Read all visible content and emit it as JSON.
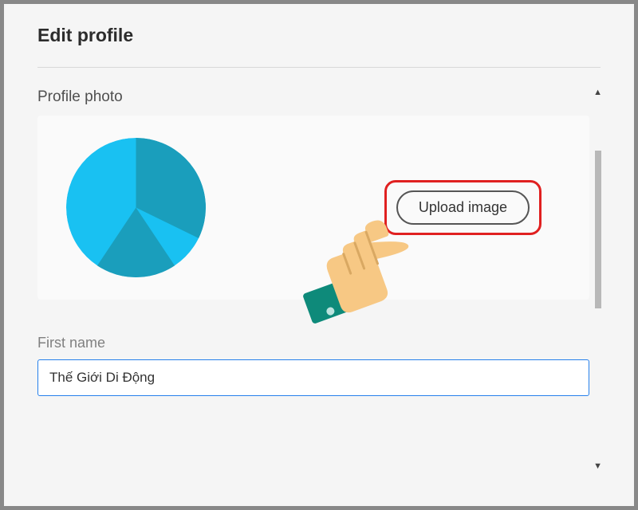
{
  "header": {
    "title": "Edit profile"
  },
  "profile_photo": {
    "section_label": "Profile photo",
    "upload_button_label": "Upload image"
  },
  "first_name": {
    "label": "First name",
    "value": "Thế Giới Di Động"
  },
  "colors": {
    "highlight": "#e02020",
    "focus_border": "#2680eb",
    "avatar_light": "#19c1f2",
    "avatar_dark": "#1a9ebc",
    "hand_skin": "#f7c884",
    "hand_cuff": "#0e8a7a"
  }
}
